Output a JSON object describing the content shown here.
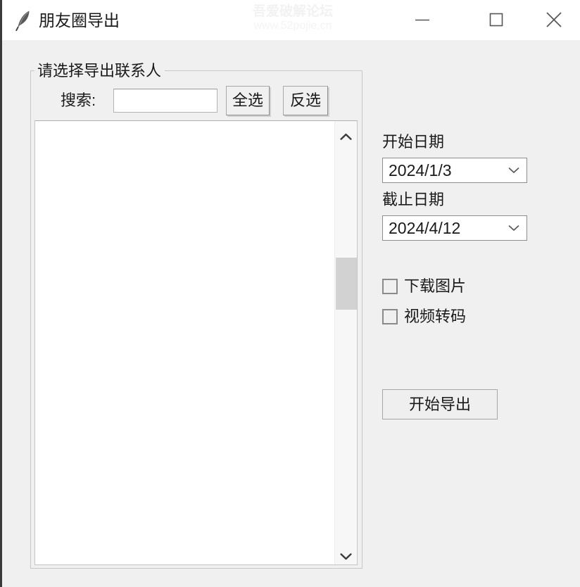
{
  "window": {
    "title": "朋友圈导出",
    "icon": "feather-quill-icon",
    "controls": {
      "minimize": "−",
      "maximize": "□",
      "close": "✕"
    }
  },
  "watermark": {
    "line1": "吾爱破解论坛",
    "line2": "www.52pojie.cn"
  },
  "contacts_group": {
    "title": "请选择导出联系人",
    "search": {
      "label": "搜索:",
      "value": "",
      "placeholder": ""
    },
    "select_all_label": "全选",
    "invert_selection_label": "反选",
    "list_items": [],
    "scrollbar": {
      "up_arrow": "chevron-up-icon",
      "down_arrow": "chevron-down-icon",
      "thumb_position_percent": 31
    }
  },
  "options_panel": {
    "start_date": {
      "label": "开始日期",
      "value": "2024/1/3"
    },
    "end_date": {
      "label": "截止日期",
      "value": "2024/4/12"
    },
    "checkboxes": [
      {
        "label": "下载图片",
        "checked": false
      },
      {
        "label": "视频转码",
        "checked": false
      }
    ],
    "export_button_label": "开始导出"
  },
  "colors": {
    "titlebar_bg": "#ffffff",
    "body_bg": "#f0f0f0",
    "text": "#1a1a1a",
    "border": "#c8c8c8",
    "field_bg": "#ffffff",
    "scroll_thumb": "#d2d2d2"
  }
}
